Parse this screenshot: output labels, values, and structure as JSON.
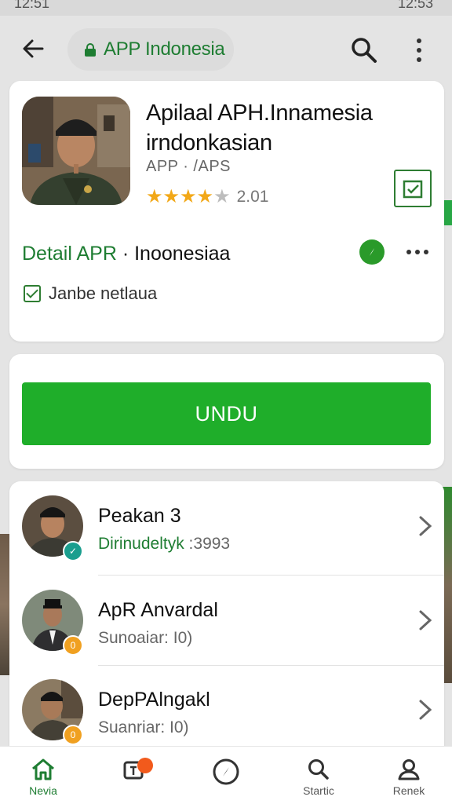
{
  "status_bar": {
    "time_left": "12:51",
    "time_right": "12:53"
  },
  "top_bar": {
    "url_text": "APP Indonesia"
  },
  "app_card": {
    "title": "Apilaal APH.Innamesia irndonkasian",
    "subtitle": "APP · /APS",
    "rating_count": "2.01",
    "detail_label": "Detail APR",
    "detail_separator": " · ",
    "detail_country": "Inoonesiaa",
    "check_label": "Janbe netlaua"
  },
  "download": {
    "label": "UNDU"
  },
  "list": {
    "items": [
      {
        "name": "Peakan 3",
        "meta_green": "Dirinudeltyk",
        "meta_rest": " :3993",
        "badge": "✓",
        "badge_color": "#1a9e8e"
      },
      {
        "name": "ApR Anvardal",
        "meta_green": "",
        "meta_rest": "Sunoaiar: I0)",
        "badge": "0",
        "badge_color": "#f0a020"
      },
      {
        "name": "DepPAlngakl",
        "meta_green": "",
        "meta_rest": "Suanriar: I0)",
        "badge": "0",
        "badge_color": "#f0a020"
      }
    ]
  },
  "bottom_nav": {
    "items": [
      {
        "label": "Nevia",
        "icon": "home-icon"
      },
      {
        "label": "",
        "icon": "updates-icon"
      },
      {
        "label": "",
        "icon": "compass-icon"
      },
      {
        "label": "Startic",
        "icon": "search-icon"
      },
      {
        "label": "Renek",
        "icon": "profile-icon"
      }
    ]
  },
  "colors": {
    "accent_green": "#1fae2a",
    "dark_green": "#1e7d32",
    "notification": "#f25a1c",
    "star": "#f2a818"
  }
}
